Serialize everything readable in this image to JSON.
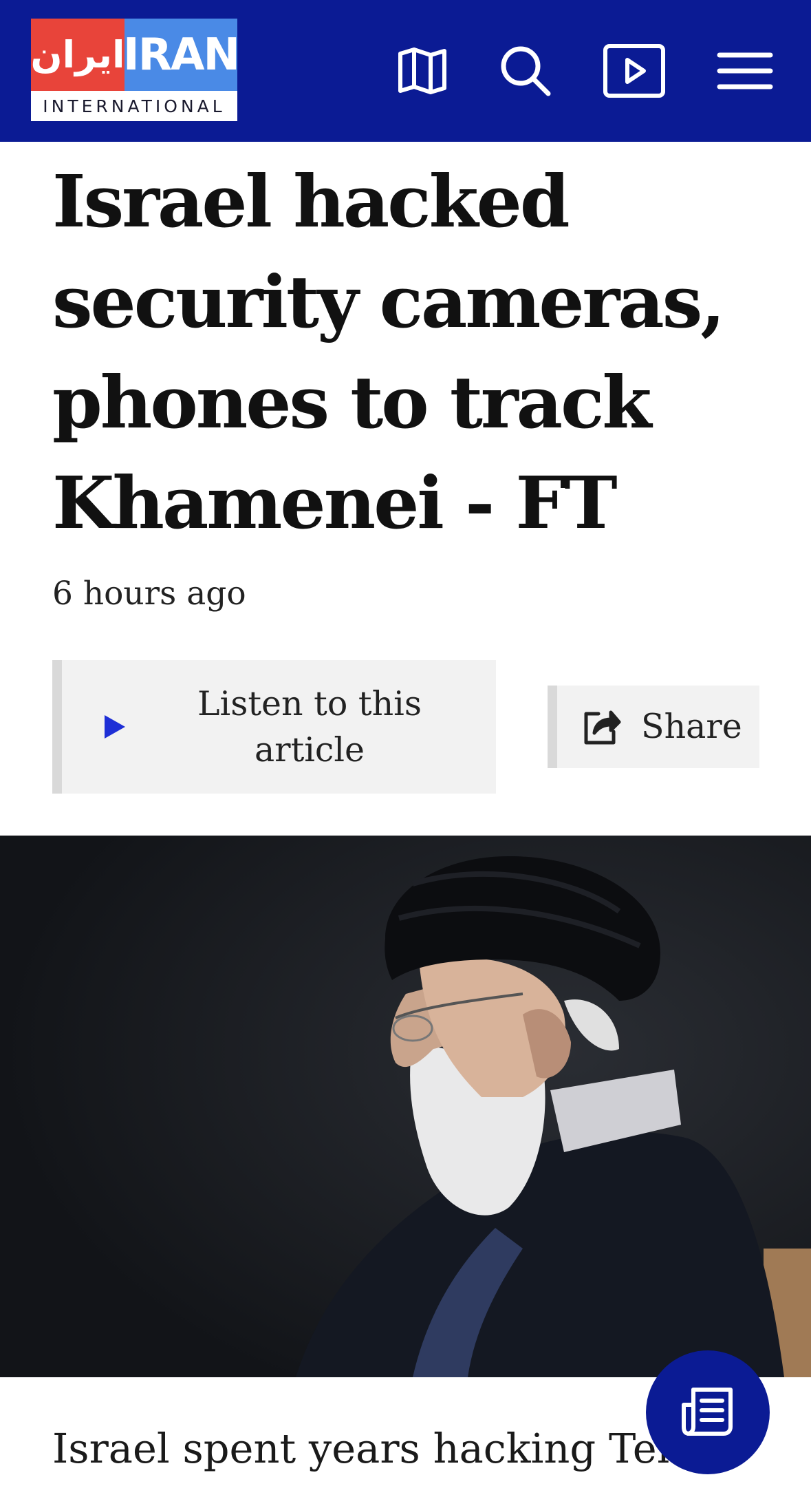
{
  "header": {
    "logo": {
      "persian": "ایران",
      "english": "IRAN",
      "subtitle": "INTERNATIONAL"
    },
    "icons": [
      "map-icon",
      "search-icon",
      "video-play-icon",
      "menu-icon"
    ],
    "background_color": "#0b1b94"
  },
  "article": {
    "headline": "Israel hacked security cameras, phones to track Khamenei - FT",
    "timestamp": "6 hours ago",
    "listen_label": "Listen to this article",
    "share_label": "Share",
    "body_preview": "Israel spent years hacking Tehra"
  },
  "floating_button": {
    "icon": "newspaper-icon"
  },
  "colors": {
    "brand_blue": "#0b1b94",
    "logo_red": "#e8443a",
    "logo_light_blue": "#4a8ae6",
    "play_blue": "#1e2fd6"
  }
}
